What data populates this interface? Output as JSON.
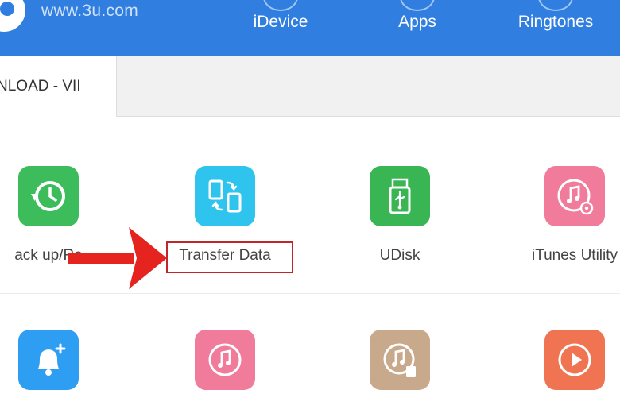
{
  "header": {
    "site_url": "www.3u.com",
    "nav": [
      {
        "label": "iDevice",
        "icon": "device-icon"
      },
      {
        "label": "Apps",
        "icon": "apps-icon"
      },
      {
        "label": "Ringtones",
        "icon": "ringtones-icon"
      }
    ],
    "colors": {
      "header_bg": "#2f7ee0"
    }
  },
  "tabs": {
    "active_label": "NLOAD - VII"
  },
  "tools": {
    "row1": [
      {
        "label": "ack up/Re",
        "icon": "backup-restore-icon",
        "color": "#3cbc5b"
      },
      {
        "label": "Transfer Data",
        "icon": "transfer-data-icon",
        "color": "#2fc4ee",
        "highlighted": true
      },
      {
        "label": "UDisk",
        "icon": "usb-icon",
        "color": "#3ab554"
      },
      {
        "label": "iTunes Utility",
        "icon": "itunes-icon",
        "color": "#f07b9a"
      }
    ],
    "row2": [
      {
        "label": "",
        "icon": "bell-icon",
        "color": "#2e9ef2"
      },
      {
        "label": "",
        "icon": "music-note-icon",
        "color": "#f07b9a"
      },
      {
        "label": "",
        "icon": "music-file-icon",
        "color": "#c9a98c"
      },
      {
        "label": "",
        "icon": "play-icon",
        "color": "#f07452"
      }
    ]
  },
  "annotation": {
    "highlight_color": "#c0272d",
    "arrow_color": "#e52420"
  }
}
